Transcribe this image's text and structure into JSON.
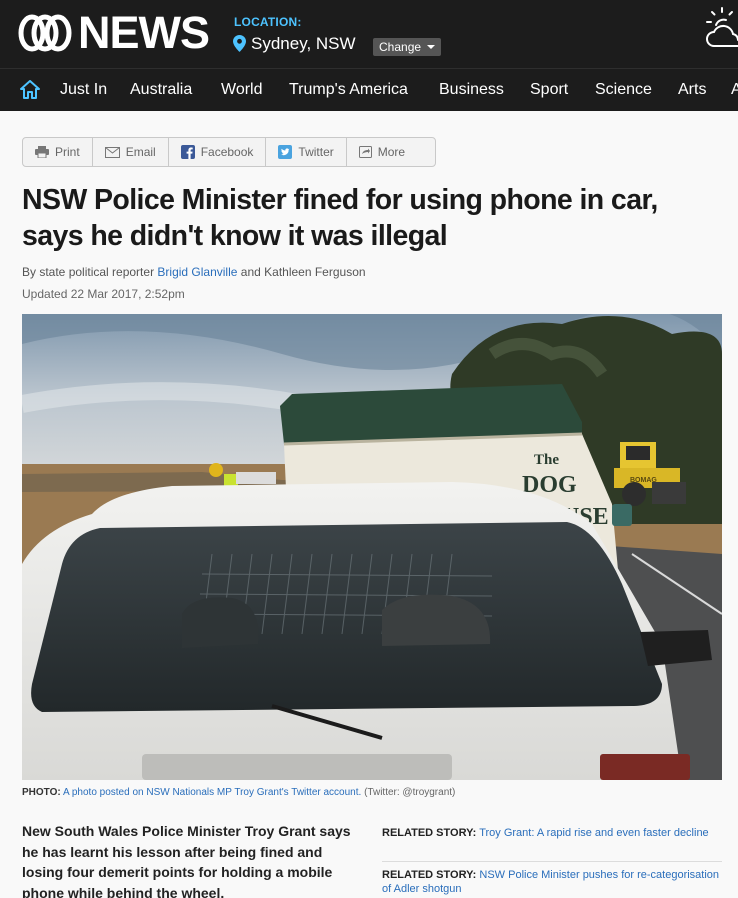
{
  "header": {
    "logo_text": "NEWS",
    "location_label": "LOCATION:",
    "location_city": "Sydney, NSW",
    "change_label": "Change",
    "weather_icon": "partly-cloudy-icon"
  },
  "nav": {
    "home_icon": "home-icon",
    "items": [
      "Just In",
      "Australia",
      "World",
      "Trump's America",
      "Business",
      "Sport",
      "Science",
      "Arts",
      "A"
    ]
  },
  "share": {
    "items": [
      {
        "label": "Print",
        "icon": "printer-icon"
      },
      {
        "label": "Email",
        "icon": "envelope-icon"
      },
      {
        "label": "Facebook",
        "icon": "facebook-icon"
      },
      {
        "label": "Twitter",
        "icon": "twitter-icon"
      },
      {
        "label": "More",
        "icon": "share-icon"
      }
    ]
  },
  "article": {
    "headline": "NSW Police Minister fined for using phone in car, says he didn't know it was illegal",
    "byline_prefix": "By state political reporter ",
    "author1": "Brigid Glanville",
    "byline_join": " and Kathleen Ferguson",
    "updated": "Updated 22 Mar 2017, 2:52pm",
    "photo": {
      "caption_label": "PHOTO:",
      "caption_link": "A photo posted on NSW Nationals MP Troy Grant's Twitter account.",
      "caption_source": "(Twitter: @troygrant)",
      "sign_line1": "The",
      "sign_line2": "DOG",
      "sign_line3": "USE",
      "roller_text": "BOMAG"
    },
    "lede": "New South Wales Police Minister Troy Grant says he has learnt his lesson after being fined and losing four demerit points for holding a mobile phone while behind the wheel."
  },
  "related": [
    {
      "label": "RELATED STORY:",
      "link": "Troy Grant: A rapid rise and even faster decline"
    },
    {
      "label": "RELATED STORY:",
      "link": "NSW Police Minister pushes for re-categorisation of Adler shotgun"
    }
  ],
  "colors": {
    "header_bg": "#1c1c1c",
    "accent_blue": "#4dc3ff",
    "link_blue": "#2a6ebb"
  }
}
